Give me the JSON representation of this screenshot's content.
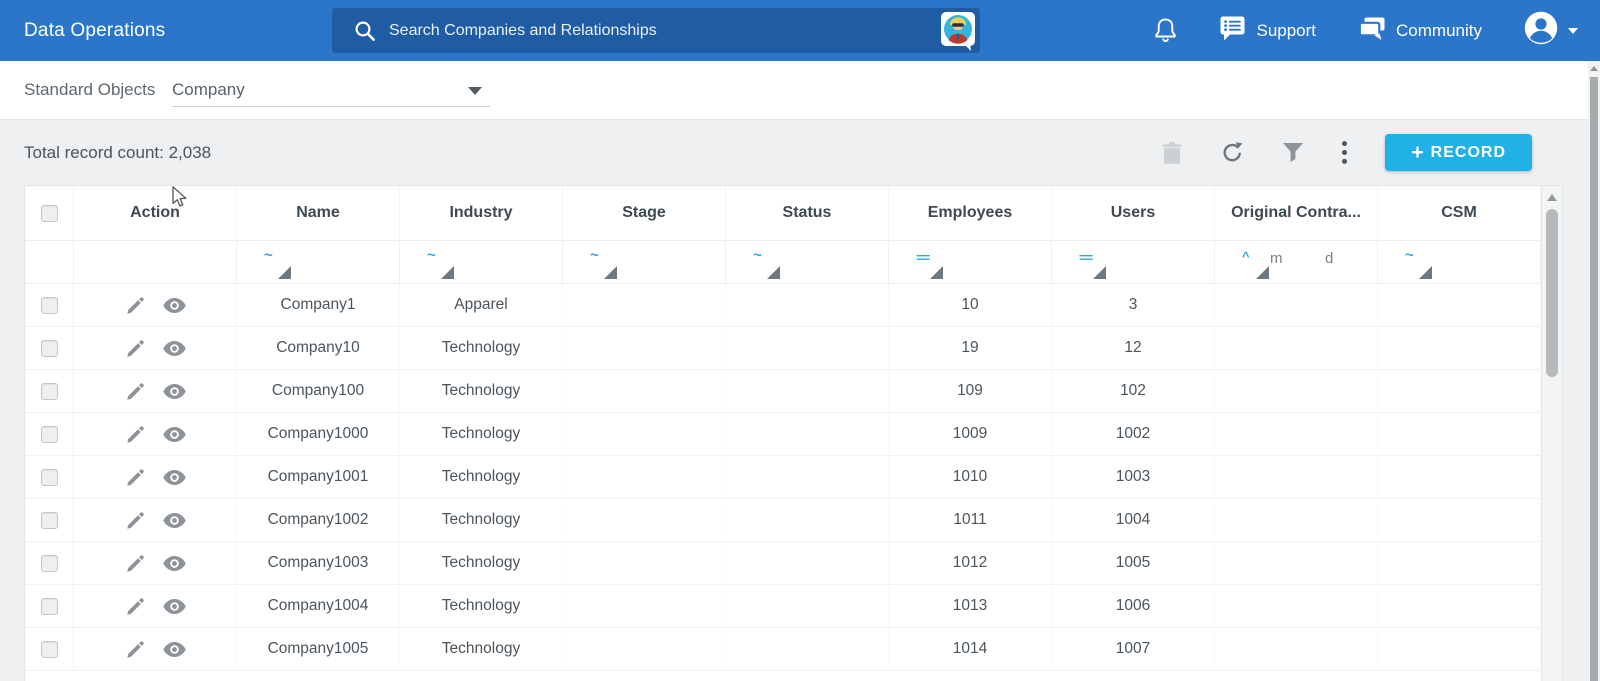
{
  "header": {
    "app_title": "Data Operations",
    "search_placeholder": "Search Companies and Relationships",
    "nav": [
      {
        "label": "Support"
      },
      {
        "label": "Community"
      }
    ]
  },
  "object_selector": {
    "label": "Standard Objects",
    "value": "Company"
  },
  "toolbar": {
    "record_count": "Total record count: 2,038",
    "add_record": {
      "plus": "+",
      "label": "RECORD"
    }
  },
  "table": {
    "columns": [
      {
        "id": "action",
        "label": "Action",
        "filter": "none"
      },
      {
        "id": "name",
        "label": "Name",
        "filter": "text"
      },
      {
        "id": "industry",
        "label": "Industry",
        "filter": "text"
      },
      {
        "id": "stage",
        "label": "Stage",
        "filter": "text"
      },
      {
        "id": "status",
        "label": "Status",
        "filter": "text"
      },
      {
        "id": "employees",
        "label": "Employees",
        "filter": "number"
      },
      {
        "id": "users",
        "label": "Users",
        "filter": "number"
      },
      {
        "id": "original_contract",
        "label": "Original Contra...",
        "filter": "date"
      },
      {
        "id": "csm",
        "label": "CSM",
        "filter": "text"
      }
    ],
    "filter_glyphs": {
      "text": "~",
      "number": "==",
      "date_caret": "^",
      "date_month": "m",
      "date_day": "d"
    },
    "rows": [
      {
        "name": "Company1",
        "industry": "Apparel",
        "stage": "",
        "status": "",
        "employees": "10",
        "users": "3",
        "original_contract": "",
        "csm": ""
      },
      {
        "name": "Company10",
        "industry": "Technology",
        "stage": "",
        "status": "",
        "employees": "19",
        "users": "12",
        "original_contract": "",
        "csm": ""
      },
      {
        "name": "Company100",
        "industry": "Technology",
        "stage": "",
        "status": "",
        "employees": "109",
        "users": "102",
        "original_contract": "",
        "csm": ""
      },
      {
        "name": "Company1000",
        "industry": "Technology",
        "stage": "",
        "status": "",
        "employees": "1009",
        "users": "1002",
        "original_contract": "",
        "csm": ""
      },
      {
        "name": "Company1001",
        "industry": "Technology",
        "stage": "",
        "status": "",
        "employees": "1010",
        "users": "1003",
        "original_contract": "",
        "csm": ""
      },
      {
        "name": "Company1002",
        "industry": "Technology",
        "stage": "",
        "status": "",
        "employees": "1011",
        "users": "1004",
        "original_contract": "",
        "csm": ""
      },
      {
        "name": "Company1003",
        "industry": "Technology",
        "stage": "",
        "status": "",
        "employees": "1012",
        "users": "1005",
        "original_contract": "",
        "csm": ""
      },
      {
        "name": "Company1004",
        "industry": "Technology",
        "stage": "",
        "status": "",
        "employees": "1013",
        "users": "1006",
        "original_contract": "",
        "csm": ""
      },
      {
        "name": "Company1005",
        "industry": "Technology",
        "stage": "",
        "status": "",
        "employees": "1014",
        "users": "1007",
        "original_contract": "",
        "csm": ""
      }
    ],
    "row_field_order": [
      "name",
      "industry",
      "stage",
      "status",
      "employees",
      "users",
      "original_contract",
      "csm"
    ]
  },
  "icons": {
    "search": "magnifier-icon",
    "search_assistant": "assistant-avatar-icon",
    "notifications": "bell-icon",
    "support": "chat-lines-icon",
    "community": "chat-double-icon",
    "account": "person-circle-icon",
    "delete": "trash-icon",
    "refresh": "refresh-icon",
    "filter": "funnel-icon",
    "more": "kebab-icon",
    "edit": "pencil-icon",
    "view": "eye-icon"
  },
  "colors": {
    "header_bg": "#2b76c9",
    "search_bg": "#1f5ca3",
    "accent_button": "#20b2e6",
    "filter_operator": "#2aa9e0",
    "page_bg": "#eef0f2"
  }
}
